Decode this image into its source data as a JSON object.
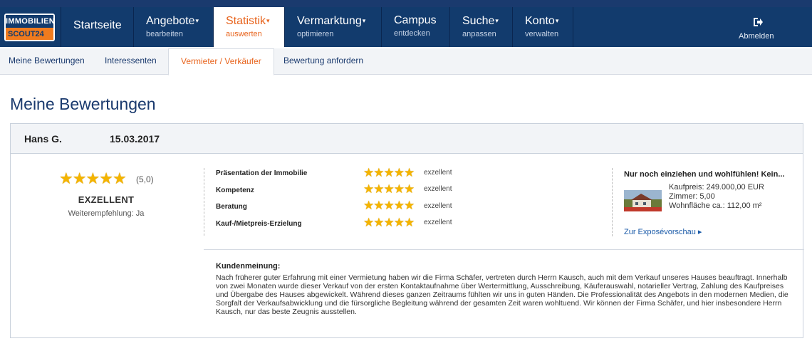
{
  "logo": {
    "line1": "IMMOBILIEN",
    "line2": "SCOUT24"
  },
  "nav": [
    {
      "title": "Startseite",
      "sub": "",
      "caret": ""
    },
    {
      "title": "Angebote",
      "sub": "bearbeiten",
      "caret": "▾"
    },
    {
      "title": "Statistik",
      "sub": "auswerten",
      "caret": "▾"
    },
    {
      "title": "Vermarktung",
      "sub": "optimieren",
      "caret": "▾"
    },
    {
      "title": "Campus",
      "sub": "entdecken",
      "caret": ""
    },
    {
      "title": "Suche",
      "sub": "anpassen",
      "caret": "▾"
    },
    {
      "title": "Konto",
      "sub": "verwalten",
      "caret": "▾"
    }
  ],
  "logout_label": "Abmelden",
  "subnav": [
    "Meine Bewertungen",
    "Interessenten",
    "Vermieter / Verkäufer",
    "Bewertung anfordern"
  ],
  "page_title": "Meine Bewertungen",
  "review": {
    "name": "Hans G.",
    "date": "15.03.2017",
    "overall_stars": 5,
    "overall_score": "(5,0)",
    "overall_label": "EXZELLENT",
    "recommendation": "Weiterempfehlung: Ja",
    "criteria": [
      {
        "label": "Präsentation der Immobilie",
        "stars": 5,
        "word": "exzellent"
      },
      {
        "label": "Kompetenz",
        "stars": 5,
        "word": "exzellent"
      },
      {
        "label": "Beratung",
        "stars": 5,
        "word": "exzellent"
      },
      {
        "label": "Kauf-/Mietpreis-Erzielung",
        "stars": 5,
        "word": "exzellent"
      }
    ],
    "expose": {
      "title": "Nur noch einziehen und wohlfühlen! Kein...",
      "price": "Kaufpreis: 249.000,00 EUR",
      "rooms": "Zimmer: 5,00",
      "area": "Wohnfläche ca.: 112,00 m²",
      "link": "Zur Exposévorschau ▸"
    },
    "opinion_label": "Kundenmeinung:",
    "opinion": "Nach früherer guter Erfahrung mit einer Vermietung haben wir die Firma Schäfer, vertreten durch Herrn Kausch, auch mit dem Verkauf unseres Hauses beauftragt. Innerhalb von zwei Monaten wurde dieser Verkauf von der ersten Kontaktaufnahme über Wertermittlung, Ausschreibung, Käuferauswahl, notarieller Vertrag, Zahlung des Kaufpreises und Übergabe des Hauses abgewickelt. Während dieses ganzen Zeitraums fühlten wir uns in guten Händen. Die Professionalität des Angebots in den modernen Medien, die Sorgfalt der Verkaufsabwicklung und die fürsorgliche Begleitung während der gesamten Zeit waren wohltuend. Wir können der Firma Schäfer, und hier insbesondere Herrn Kausch, nur das beste Zeugnis ausstellen."
  },
  "colors": {
    "nav_bg": "#123b6d",
    "accent": "#e8641d",
    "star": "#f4b400",
    "link": "#1a5aa8"
  }
}
